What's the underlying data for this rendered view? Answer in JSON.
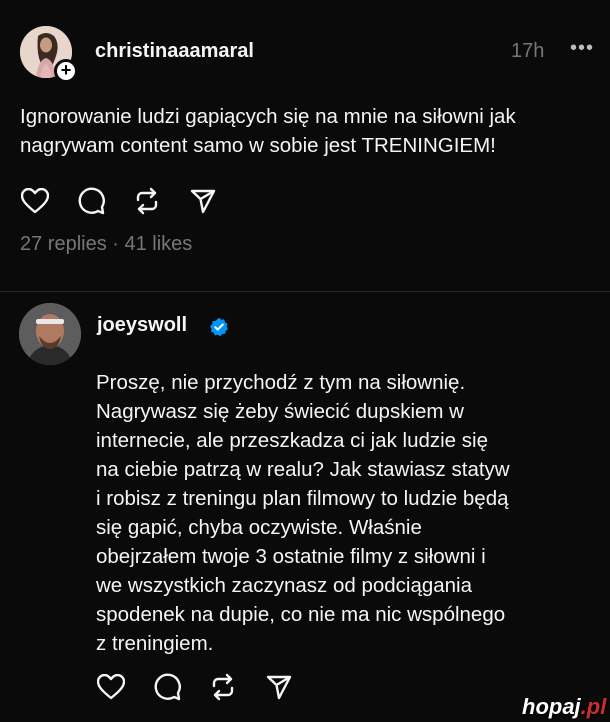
{
  "post1": {
    "username": "christinaaamaral",
    "time": "17h",
    "more": "•••",
    "text_lines": [
      "Ignorowanie ludzi gapiących się na mnie na siłowni jak",
      "nagrywam content samo w sobie jest TRENINGIEM!"
    ],
    "stats": "27 replies · 41 likes"
  },
  "post2": {
    "username": "joeyswoll",
    "text_lines": [
      "Proszę, nie przychodź z tym na siłownię.",
      "Nagrywasz się żeby świecić dupskiem w",
      "internecie, ale przeszkadza ci jak ludzie się",
      "na ciebie patrzą w realu? Jak stawiasz statyw",
      "i robisz z treningu plan filmowy to ludzie będą",
      "się gapić, chyba oczywiste. Właśnie",
      "obejrzałem twoje 3 ostatnie filmy z siłowni i",
      "we wszystkich zaczynasz od podciągania",
      "spodenek na dupie, co nie ma nic wspólnego",
      "z treningiem."
    ]
  },
  "watermark": {
    "name": "hopaj",
    "tld": ".pl"
  },
  "icons": [
    "heart-icon",
    "comment-icon",
    "repost-icon",
    "share-icon",
    "verified-icon",
    "plus-icon"
  ],
  "colors": {
    "background": "#0a0a0a",
    "text": "#f3f5f7",
    "muted": "#777777",
    "verified": "#0095f6",
    "brand_accent": "#c9302c"
  }
}
